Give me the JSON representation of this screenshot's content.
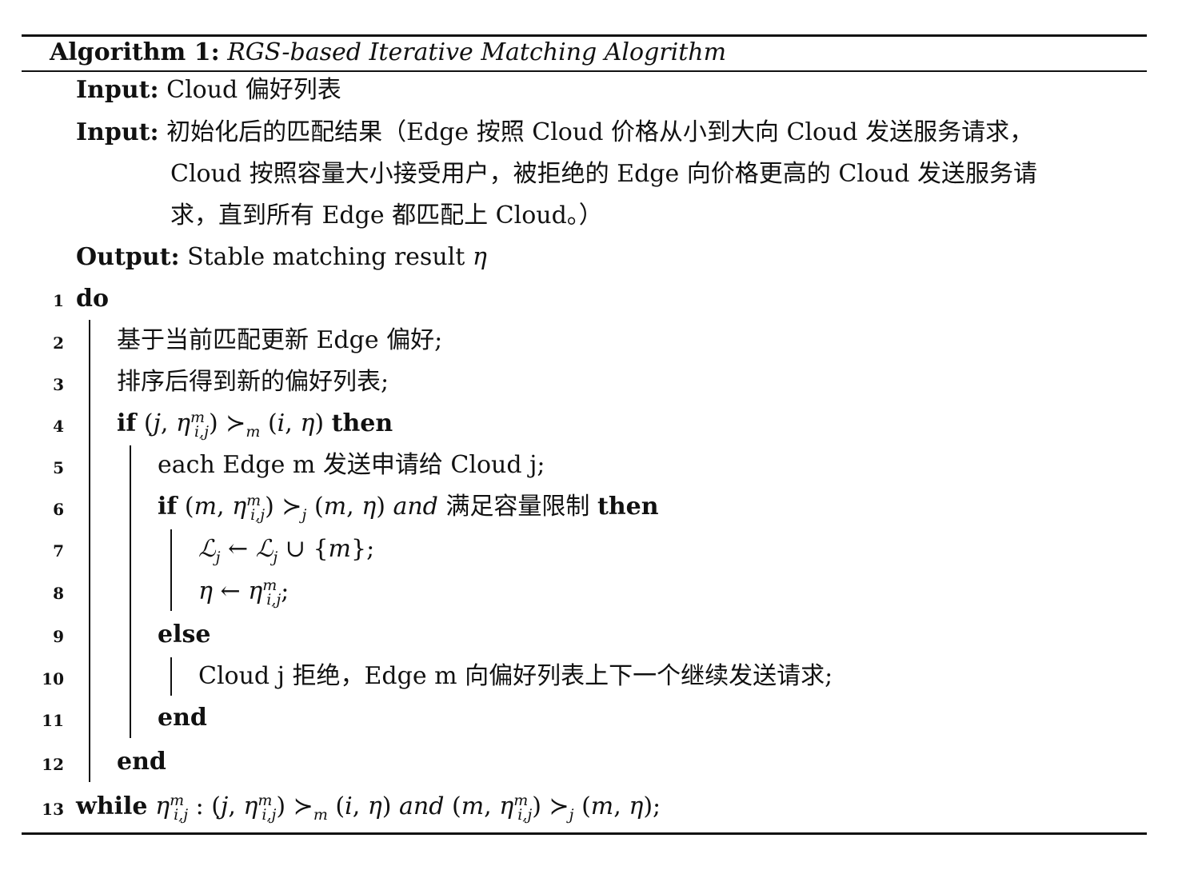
{
  "algorithm": {
    "label": "Algorithm 1:",
    "title": "RGS-based Iterative Matching Alogrithm"
  },
  "inputs": [
    {
      "label": "Input:",
      "text": "Cloud 偏好列表"
    },
    {
      "label": "Input:",
      "lines": [
        "初始化后的匹配结果（Edge 按照 Cloud 价格从小到大向 Cloud 发送服务请求，",
        "Cloud 按照容量大小接受用户，被拒绝的 Edge 向价格更高的 Cloud 发送服务请",
        "求，直到所有 Edge 都匹配上 Cloud。）"
      ]
    }
  ],
  "output": {
    "label": "Output:",
    "text": "Stable matching result",
    "symbol": "η"
  },
  "lines": [
    {
      "no": "1",
      "kw": "do"
    },
    {
      "no": "2",
      "text": "基于当前匹配更新 Edge 偏好;"
    },
    {
      "no": "3",
      "text": "排序后得到新的偏好列表;"
    },
    {
      "no": "4",
      "kw": "if",
      "kw_end": "then"
    },
    {
      "no": "5",
      "text": "each Edge m 发送申请给 Cloud j;"
    },
    {
      "no": "6",
      "kw": "if",
      "cond_text": "满足容量限制",
      "kw_end": "then"
    },
    {
      "no": "7"
    },
    {
      "no": "8"
    },
    {
      "no": "9",
      "kw": "else"
    },
    {
      "no": "10",
      "text": "Cloud j 拒绝，Edge m 向偏好列表上下一个继续发送请求;"
    },
    {
      "no": "11",
      "kw": "end"
    },
    {
      "no": "12",
      "kw": "end"
    },
    {
      "no": "13",
      "kw": "while"
    }
  ]
}
